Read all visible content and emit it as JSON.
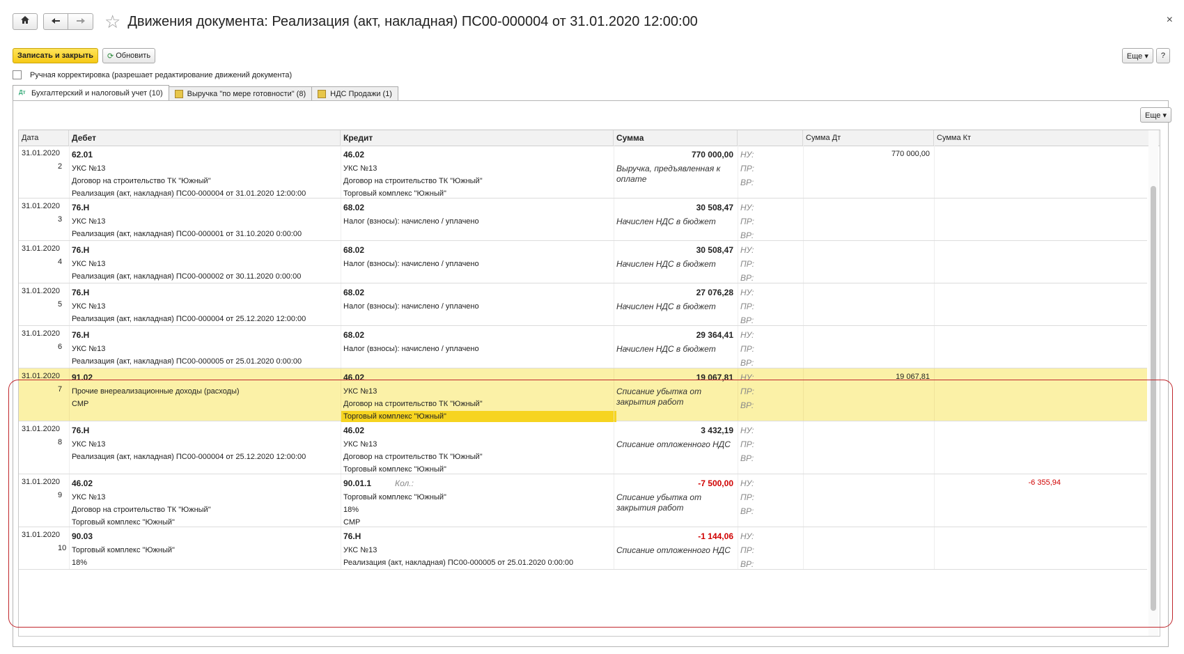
{
  "title": "Движения документа: Реализация (акт, накладная) ПС00-000004 от 31.01.2020 12:00:00",
  "toolbar": {
    "save_close": "Записать и закрыть",
    "refresh": "Обновить",
    "more": "Еще ▾",
    "help": "?"
  },
  "manual_correction_label": "Ручная корректировка (разрешает редактирование движений документа)",
  "tabs": [
    {
      "label": "Бухгалтерский и налоговый учет (10)"
    },
    {
      "label": "Выручка \"по мере готовности\" (8)"
    },
    {
      "label": "НДС Продажи (1)"
    }
  ],
  "panel": {
    "more": "Еще ▾"
  },
  "columns": {
    "date": "Дата",
    "debit": "Дебет",
    "credit": "Кредит",
    "sum": "Сумма",
    "nu": "",
    "sum_dt": "Сумма Дт",
    "sum_kt": "Сумма Кт"
  },
  "labels": {
    "nu": "НУ:",
    "pr": "ПР:",
    "vr": "ВР:",
    "qty": "Кол.:"
  },
  "rows": [
    {
      "date": "31.01.2020",
      "num": "2",
      "d_acc": "62.01",
      "d1": "УКС №13",
      "d2": "Договор на строительство ТК \"Южный\"",
      "d3": "Реализация (акт, накладная) ПС00-000004 от 31.01.2020 12:00:00",
      "c_acc": "46.02",
      "c1": "УКС №13",
      "c2": "Договор на строительство ТК \"Южный\"",
      "c3": "Торговый комплекс \"Южный\"",
      "sum": "770 000,00",
      "content": "Выручка, предъявленная к оплате",
      "sum_dt": "770 000,00",
      "sum_kt": ""
    },
    {
      "date": "31.01.2020",
      "num": "3",
      "d_acc": "76.Н",
      "d1": "УКС №13",
      "d2": "Реализация (акт, накладная) ПС00-000001 от 31.10.2020 0:00:00",
      "d3": "",
      "c_acc": "68.02",
      "c1": "Налог (взносы): начислено / уплачено",
      "c2": "",
      "c3": "",
      "sum": "30 508,47",
      "content": "Начислен НДС в бюджет",
      "sum_dt": "",
      "sum_kt": ""
    },
    {
      "date": "31.01.2020",
      "num": "4",
      "d_acc": "76.Н",
      "d1": "УКС №13",
      "d2": "Реализация (акт, накладная) ПС00-000002 от 30.11.2020 0:00:00",
      "d3": "",
      "c_acc": "68.02",
      "c1": "Налог (взносы): начислено / уплачено",
      "c2": "",
      "c3": "",
      "sum": "30 508,47",
      "content": "Начислен НДС в бюджет",
      "sum_dt": "",
      "sum_kt": ""
    },
    {
      "date": "31.01.2020",
      "num": "5",
      "d_acc": "76.Н",
      "d1": "УКС №13",
      "d2": "Реализация (акт, накладная) ПС00-000004 от 25.12.2020 12:00:00",
      "d3": "",
      "c_acc": "68.02",
      "c1": "Налог (взносы): начислено / уплачено",
      "c2": "",
      "c3": "",
      "sum": "27 076,28",
      "content": "Начислен НДС в бюджет",
      "sum_dt": "",
      "sum_kt": ""
    },
    {
      "date": "31.01.2020",
      "num": "6",
      "d_acc": "76.Н",
      "d1": "УКС №13",
      "d2": "Реализация (акт, накладная) ПС00-000005 от 25.01.2020 0:00:00",
      "d3": "",
      "c_acc": "68.02",
      "c1": "Налог (взносы): начислено / уплачено",
      "c2": "",
      "c3": "",
      "sum": "29 364,41",
      "content": "Начислен НДС в бюджет",
      "sum_dt": "",
      "sum_kt": ""
    },
    {
      "date": "31.01.2020",
      "num": "7",
      "d_acc": "91.02",
      "d1": "Прочие внереализационные доходы (расходы)",
      "d2": "СМР",
      "d3": "",
      "c_acc": "46.02",
      "c1": "УКС №13",
      "c2": "Договор на строительство ТК \"Южный\"",
      "c3": "Торговый комплекс \"Южный\"",
      "sum": "19 067,81",
      "content": "Списание убытка от закрытия работ",
      "sum_dt": "19 067,81",
      "sum_kt": ""
    },
    {
      "date": "31.01.2020",
      "num": "8",
      "d_acc": "76.Н",
      "d1": "УКС №13",
      "d2": "Реализация (акт, накладная) ПС00-000004 от 25.12.2020 12:00:00",
      "d3": "",
      "c_acc": "46.02",
      "c1": "УКС №13",
      "c2": "Договор на строительство ТК \"Южный\"",
      "c3": "Торговый комплекс \"Южный\"",
      "sum": "3 432,19",
      "content": "Списание отложенного НДС",
      "sum_dt": "",
      "sum_kt": ""
    },
    {
      "date": "31.01.2020",
      "num": "9",
      "d_acc": "46.02",
      "d1": "УКС №13",
      "d2": "Договор на строительство ТК \"Южный\"",
      "d3": "Торговый комплекс \"Южный\"",
      "c_acc": "90.01.1",
      "c1": "Торговый комплекс \"Южный\"",
      "c2": "18%",
      "c3": "СМР",
      "sum": "-7 500,00",
      "content": "Списание убытка от закрытия работ",
      "sum_dt": "",
      "sum_kt": "-6 355,94"
    },
    {
      "date": "31.01.2020",
      "num": "10",
      "d_acc": "90.03",
      "d1": "Торговый комплекс \"Южный\"",
      "d2": "18%",
      "d3": "",
      "c_acc": "76.Н",
      "c1": "УКС №13",
      "c2": "Реализация (акт, накладная) ПС00-000005 от 25.01.2020 0:00:00",
      "c3": "",
      "sum": "-1 144,06",
      "content": "Списание отложенного НДС",
      "sum_dt": "",
      "sum_kt": ""
    }
  ]
}
